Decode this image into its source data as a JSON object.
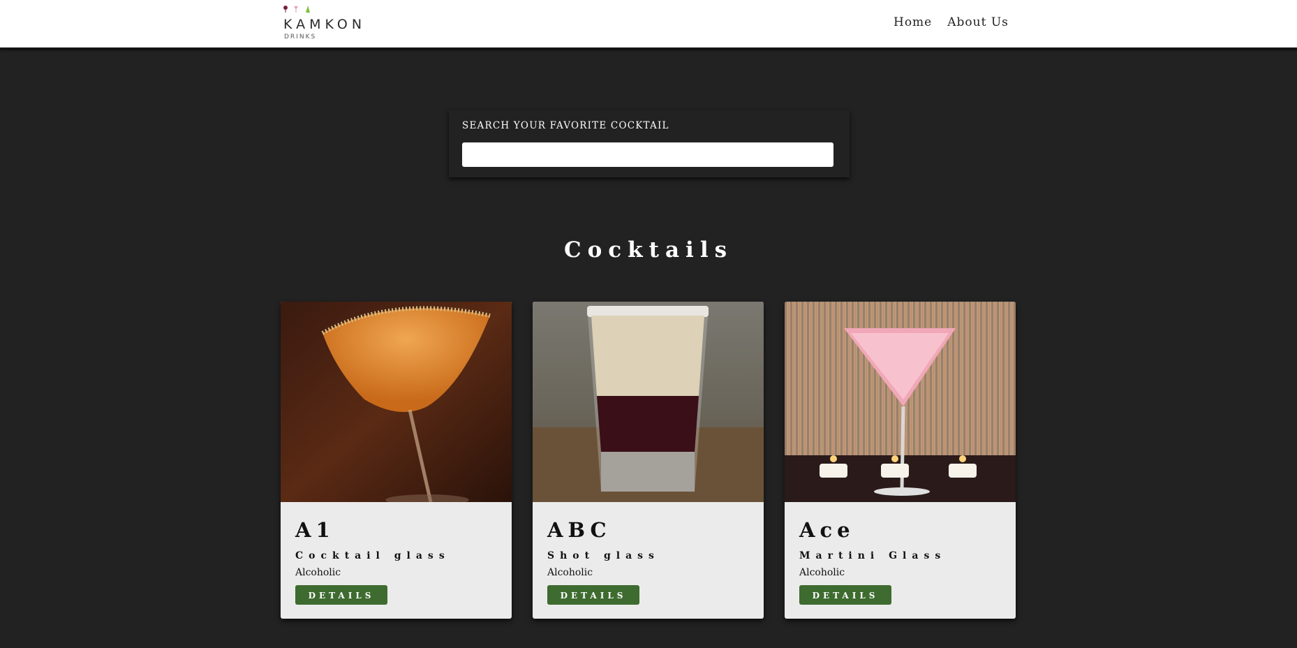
{
  "nav": {
    "brand": "KAMKON",
    "brand_sub": "DRINKS",
    "links": [
      "Home",
      "About Us"
    ]
  },
  "search": {
    "label": "SEARCH YOUR FAVORITE COCKTAIL",
    "value": "",
    "placeholder": ""
  },
  "section": {
    "title": "Cocktails"
  },
  "details_label": "DETAILS",
  "cards": [
    {
      "name": "A1",
      "glass": "Cocktail glass",
      "type": "Alcoholic",
      "image": "orange-martini-cocktail-photo"
    },
    {
      "name": "ABC",
      "glass": "Shot glass",
      "type": "Alcoholic",
      "image": "layered-shot-glass-photo"
    },
    {
      "name": "Ace",
      "glass": "Martini Glass",
      "type": "Alcoholic",
      "image": "pink-martini-with-candles-photo"
    }
  ],
  "colors": {
    "page_bg": "#222222",
    "navbar_bg": "#ffffff",
    "card_bg": "#ebebeb",
    "button_bg": "#3e6b2f"
  }
}
